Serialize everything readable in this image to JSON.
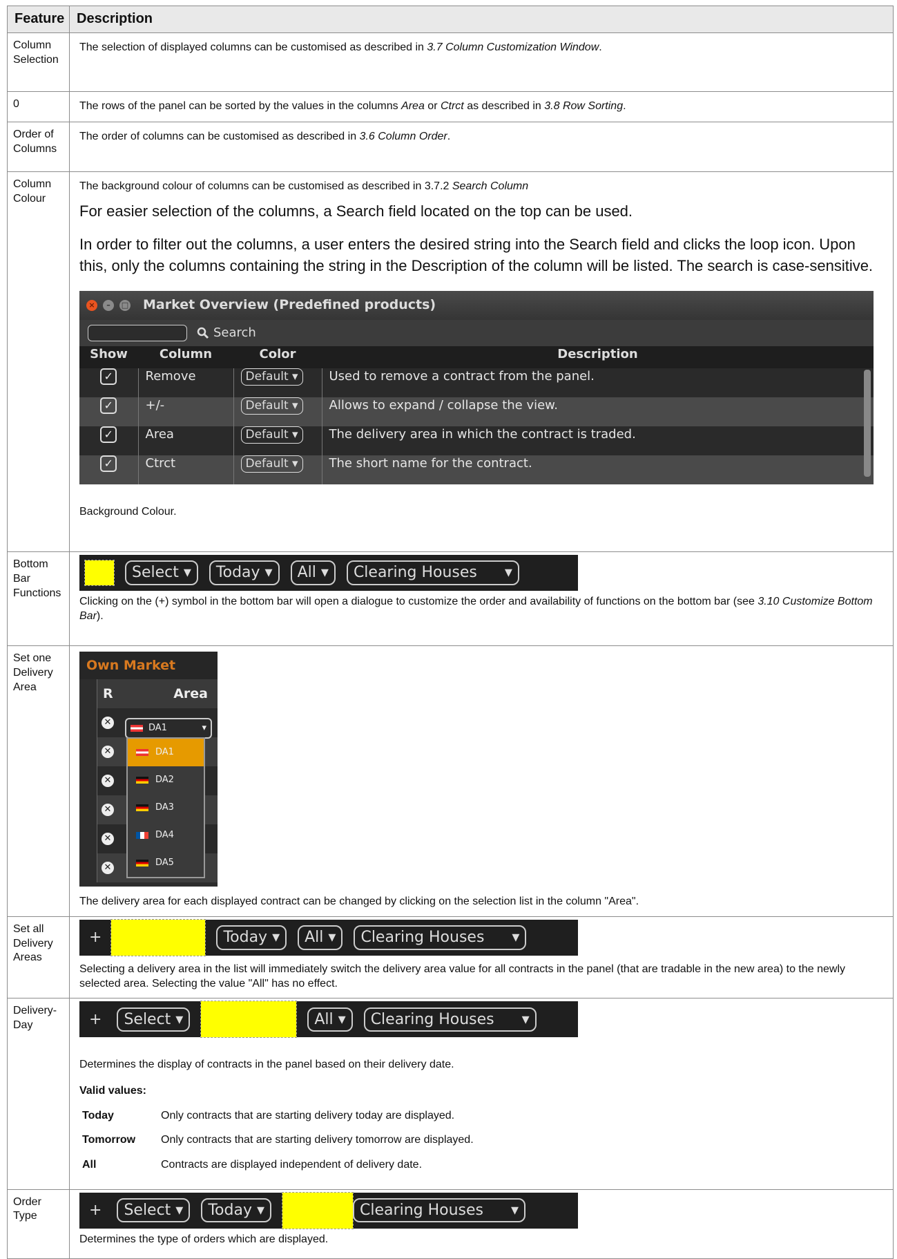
{
  "headers": {
    "feature": "Feature",
    "description": "Description"
  },
  "rows": {
    "r1": {
      "feature": "Column Selection",
      "pre": "The selection of displayed columns can be customised as described in ",
      "ref": "3.7 Column Customization Window",
      "post": "."
    },
    "r2": {
      "feature": "0",
      "pre": "The rows of the panel can be sorted by the values in the columns ",
      "ref1": "Area",
      "mid": " or ",
      "ref2": "Ctrct",
      "mid2": " as described in ",
      "ref3": "3.8 Row Sorting",
      "post": "."
    },
    "r3": {
      "feature": "Order of Columns",
      "pre": "The order of columns can be customised as described in ",
      "ref": "3.6 Column Order",
      "post": "."
    },
    "r4": {
      "feature": "Column Colour",
      "pre": "The background colour of columns can be customised as described in 3.7.2 ",
      "ref": "Search Column",
      "p1": "For easier selection of the columns, a Search field located on the top can be used.",
      "p2": "In order to filter out the columns, a user enters the desired string into the Search field and clicks the loop icon. Upon this, only the columns containing the string in the Description of the column will be listed. The search is case-sensitive.",
      "window": {
        "title": "Market Overview (Predefined products)",
        "search_label": "Search",
        "columns": [
          "Show",
          "Column",
          "Color",
          "Description"
        ],
        "items": [
          {
            "column": "Remove",
            "color": "Default",
            "description": "Used to remove a contract from the panel."
          },
          {
            "column": "+/-",
            "color": "Default",
            "description": "Allows to expand / collapse the view."
          },
          {
            "column": "Area",
            "color": "Default",
            "description": "The delivery area in which the contract is traded."
          },
          {
            "column": "Ctrct",
            "color": "Default",
            "description": "The short name for the contract."
          }
        ]
      },
      "caption": "Background Colour."
    },
    "r5": {
      "feature": "Bottom Bar Functions",
      "bar": {
        "select": "Select",
        "today": "Today",
        "all": "All",
        "clearing": "Clearing Houses"
      },
      "pre": "Clicking on the (+) symbol in the bottom bar will open a dialogue to customize the order and availability of functions on the bottom bar (see ",
      "ref": "3.10 Customize Bottom Bar",
      "post": ")."
    },
    "r6": {
      "feature": "Set one Delivery Area",
      "panel": {
        "title": "Own Market",
        "col_r": "R",
        "col_area": "Area",
        "selected": "DA1",
        "options": [
          "DA1",
          "DA2",
          "DA3",
          "DA4",
          "DA5"
        ]
      },
      "caption": "The delivery area for each displayed contract can be changed by clicking on the selection list in the column \"Area\"."
    },
    "r7": {
      "feature": "Set all Delivery Areas",
      "bar": {
        "plus": "+",
        "today": "Today",
        "all": "All",
        "clearing": "Clearing Houses"
      },
      "caption": "Selecting a delivery area in the list will immediately switch the delivery area value for all contracts in the panel (that are tradable in the new area) to the newly selected area. Selecting the value \"All\" has no effect."
    },
    "r8": {
      "feature": "Delivery-Day",
      "bar": {
        "plus": "+",
        "select": "Select",
        "all": "All",
        "clearing": "Clearing Houses"
      },
      "caption": "Determines the display of contracts in the panel based on their delivery date.",
      "valid_heading": "Valid values:",
      "values": [
        {
          "key": "Today",
          "text": "Only contracts that are starting delivery today are displayed."
        },
        {
          "key": "Tomorrow",
          "text": "Only contracts that are starting delivery tomorrow are displayed."
        },
        {
          "key": "All",
          "text": "Contracts are displayed independent of delivery date."
        }
      ]
    },
    "r9": {
      "feature": "Order Type",
      "bar": {
        "plus": "+",
        "select": "Select",
        "today": "Today",
        "clearing": "Clearing Houses"
      },
      "caption": "Determines the type of orders which are displayed."
    }
  },
  "colors": {
    "highlight": "#ffff00",
    "dark_bg": "#1f1f1f",
    "own_market": "#d8791f",
    "dropdown_selected": "#e69a00"
  }
}
